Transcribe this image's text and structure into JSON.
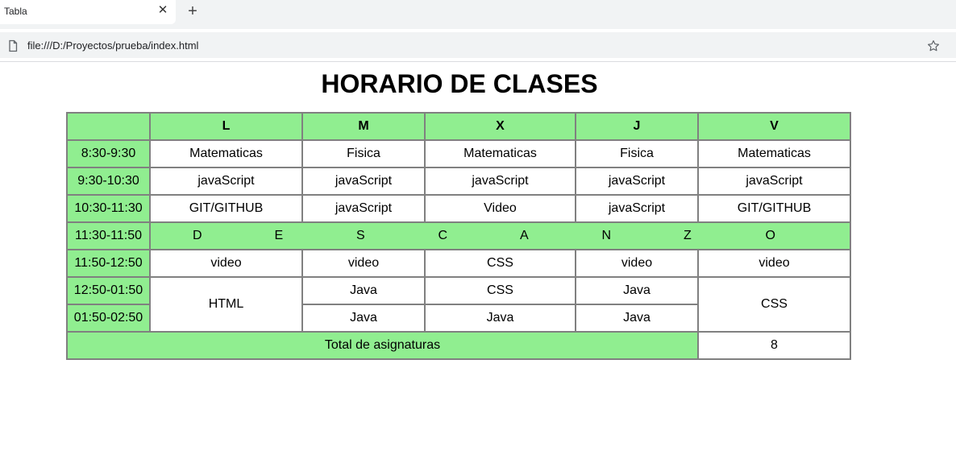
{
  "browser": {
    "tab_title": "Tabla",
    "close_symbol": "✕",
    "new_tab_symbol": "+",
    "url": "file:///D:/Proyectos/prueba/index.html"
  },
  "page": {
    "title": "HORARIO DE CLASES",
    "days": [
      "L",
      "M",
      "X",
      "J",
      "V"
    ],
    "rows": [
      {
        "time": "8:30-9:30",
        "cells": [
          "Matematicas",
          "Fisica",
          "Matematicas",
          "Fisica",
          "Matematicas"
        ]
      },
      {
        "time": "9:30-10:30",
        "cells": [
          "javaScript",
          "javaScript",
          "javaScript",
          "javaScript",
          "javaScript"
        ]
      },
      {
        "time": "10:30-11:30",
        "cells": [
          "GIT/GITHUB",
          "javaScript",
          "Video",
          "javaScript",
          "GIT/GITHUB"
        ]
      },
      {
        "time": "11:30-11:50",
        "break_letters": [
          "D",
          "E",
          "S",
          "C",
          "A",
          "N",
          "Z",
          "O"
        ]
      },
      {
        "time": "11:50-12:50",
        "cells": [
          "video",
          "video",
          "CSS",
          "video",
          "video"
        ]
      },
      {
        "time": "12:50-01:50",
        "cells": [
          "HTML",
          "Java",
          "CSS",
          "Java",
          "CSS"
        ]
      },
      {
        "time": "01:50-02:50",
        "cells": [
          "Java",
          "Java",
          "Java"
        ]
      }
    ],
    "footer": {
      "label": "Total de asignaturas",
      "value": "8"
    },
    "colors": {
      "header_bg": "#90ee90",
      "border": "#808080"
    }
  }
}
